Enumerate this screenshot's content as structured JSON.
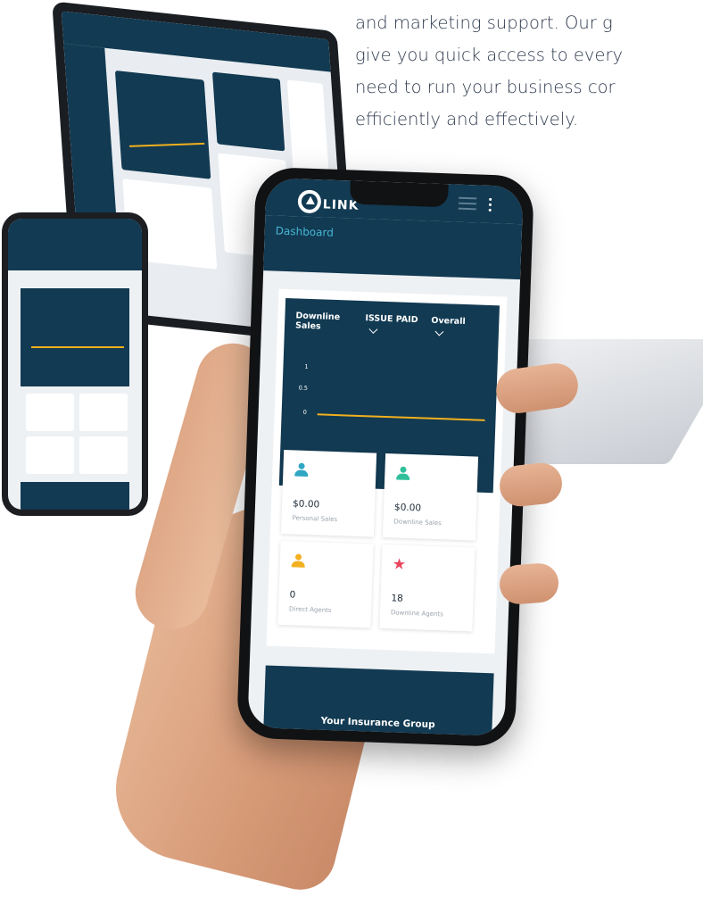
{
  "copy": {
    "lines": [
      "and marketing support. Our g",
      "give you quick access to every",
      "need to run your business cor",
      "efficiently and effectively."
    ]
  },
  "app": {
    "logo_text": "LINK",
    "page_title": "Dashboard"
  },
  "filters": {
    "metric": "Downline Sales",
    "status": "ISSUE PAID",
    "period": "Overall"
  },
  "chart_data": {
    "type": "line",
    "y_ticks": [
      "1",
      "0.5",
      "0"
    ],
    "series": [
      {
        "values": [
          0,
          0
        ]
      }
    ],
    "ylim": [
      0,
      1
    ],
    "line_color": "#f2b01e"
  },
  "stats": [
    {
      "value": "$0.00",
      "label": "Personal Sales",
      "icon": "person-icon",
      "color": "#2fa6c4"
    },
    {
      "value": "$0.00",
      "label": "Downline Sales",
      "icon": "group-icon",
      "color": "#2fbf9a"
    },
    {
      "value": "0",
      "label": "Direct Agents",
      "icon": "agents-icon",
      "color": "#f2b01e"
    },
    {
      "value": "18",
      "label": "Downline Agents",
      "icon": "star-icon",
      "color": "#e9455c"
    }
  ],
  "footer_card": {
    "title": "Your Insurance Group"
  },
  "colors": {
    "primary": "#123a52",
    "accent": "#46b6d6",
    "chart_line": "#f2b01e"
  }
}
